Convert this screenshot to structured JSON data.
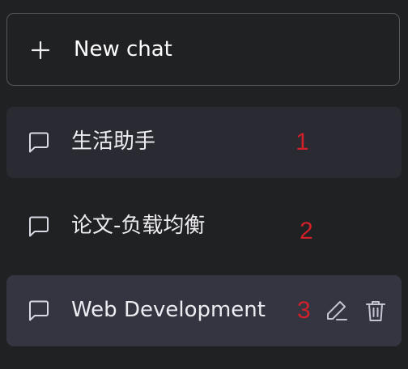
{
  "new_chat": {
    "label": "New chat",
    "icon": "plus-icon"
  },
  "conversations": [
    {
      "title": "生活助手",
      "marker": "1",
      "state": "hover"
    },
    {
      "title": "论文-负载均衡",
      "marker": "2",
      "state": "normal"
    },
    {
      "title": "Web Development",
      "marker": "3",
      "state": "active",
      "actions": [
        "edit-icon",
        "trash-icon"
      ]
    }
  ],
  "colors": {
    "background": "#202123",
    "hover_background": "#2a2b32",
    "active_background": "#343541",
    "border": "#56575e",
    "text": "#ececf1",
    "marker": "#d0202a",
    "icon": "#c5c5d2"
  }
}
